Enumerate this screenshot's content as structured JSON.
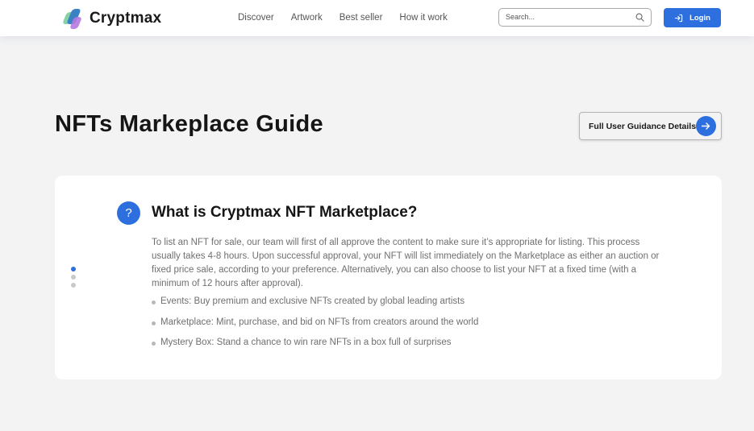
{
  "header": {
    "brand": "Cryptmax",
    "nav": [
      {
        "label": "Discover"
      },
      {
        "label": "Artwork"
      },
      {
        "label": "Best seller"
      },
      {
        "label": "How it work"
      }
    ],
    "search": {
      "placeholder": "Search...",
      "value": "",
      "icon": "search-icon"
    },
    "login": {
      "label": "Login",
      "icon": "login-icon"
    }
  },
  "page": {
    "title": "NFTs Markeplace Guide",
    "guide_button": {
      "label": "Full User Guidance Details",
      "icon": "arrow-right-icon"
    }
  },
  "faq": {
    "icon_glyph": "?",
    "question": "What is Cryptmax NFT Marketplace?",
    "answer": "To list an NFT for sale, our team will first of all approve the content to make sure it’s appropriate for listing. This process usually takes 4-8 hours. Upon successful approval, your NFT will list immediately on the Marketplace as either an auction or fixed price sale, according to your preference. Alternatively, you can also choose to list your NFT at a fixed time (with a minimum of 12 hours after approval).",
    "bullets": [
      "Events: Buy premium and exclusive NFTs created by global leading artists",
      "Marketplace: Mint, purchase, and bid on NFTs from creators around the world",
      "Mystery Box: Stand a chance to win rare NFTs in a box full of surprises"
    ],
    "pagination": {
      "total": 3,
      "active": 1
    }
  },
  "colors": {
    "accent": "#2e6fe0",
    "background": "#f3f3f3",
    "card": "#ffffff"
  }
}
